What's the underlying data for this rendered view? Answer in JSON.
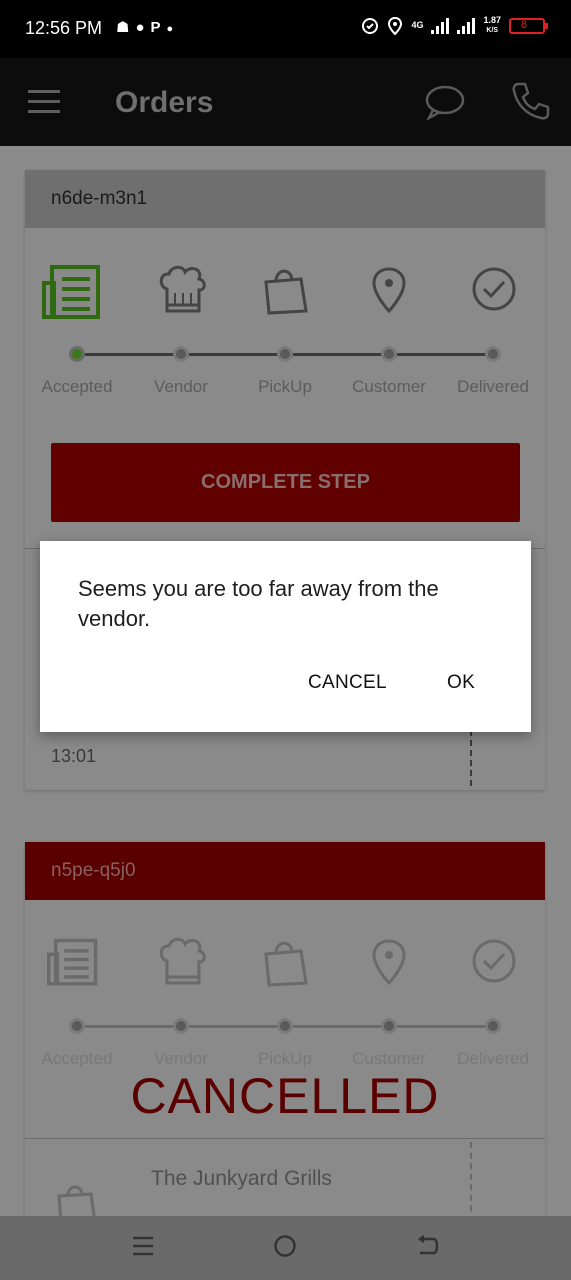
{
  "status_bar": {
    "time": "12:56 PM",
    "network": "4G",
    "speed": "1.87",
    "speed_unit": "K/S",
    "battery": "8",
    "notification_icons": [
      "incognito-icon",
      "message-icon",
      "p-icon",
      "drop-icon"
    ],
    "right_icons": [
      "alarm-icon",
      "location-icon",
      "signal-icon",
      "battery-icon"
    ]
  },
  "app_bar": {
    "title": "Orders",
    "icons": [
      "menu-icon",
      "chat-icon",
      "phone-icon"
    ]
  },
  "orders": [
    {
      "id": "n6de-m3n1",
      "steps": [
        "Accepted",
        "Vendor",
        "PickUp",
        "Customer",
        "Delivered"
      ],
      "active_step": 0,
      "action_label": "COMPLETE STEP",
      "time": "13:01"
    },
    {
      "id": "n5pe-q5j0",
      "steps": [
        "Accepted",
        "Vendor",
        "PickUp",
        "Customer",
        "Delivered"
      ],
      "status": "CANCELLED",
      "vendor": "The Junkyard Grills"
    }
  ],
  "dialog": {
    "message": "Seems you are too far away from the vendor.",
    "cancel_label": "CANCEL",
    "ok_label": "OK"
  },
  "nav_bar": {
    "icons": [
      "recents-icon",
      "home-icon",
      "back-icon"
    ]
  },
  "colors": {
    "accent_red": "#b00000",
    "active_green": "#5fb82a",
    "scrim": "#8a8a8a"
  }
}
